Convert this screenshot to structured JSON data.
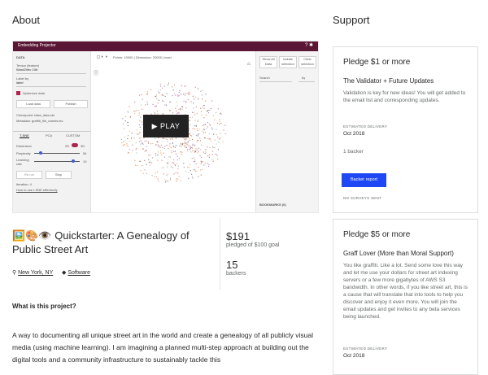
{
  "about_heading": "About",
  "support_heading": "Support",
  "video": {
    "app_title": "Embedding Projector",
    "data_label": "DATA",
    "tensor_label": "Tensor (feature)",
    "tensor_value": "Word2Vec 10K",
    "label_by_label": "Label by",
    "label_by_value": "label",
    "sphereize_label": "Sphereize data",
    "load_btn": "Load data",
    "publish_btn": "Publish",
    "checkpoint_text": "Checkpoint: false_data.ckt",
    "metadata_text": "Metadata: graffiti_file_names.tsv",
    "tabs": [
      "T-SNE",
      "PCA",
      "CUSTOM"
    ],
    "dimension_label": "Dimension",
    "dim_2d": "2D",
    "dim_3d": "3D",
    "perplexity_label": "Perplexity",
    "perplexity_value": "54",
    "learning_label": "Learning rate",
    "learning_value": "10",
    "rerun_btn": "Re-run",
    "stop_btn": "Stop",
    "iteration_text": "Iteration: 4",
    "how_link": "How to use t-SNE effectively",
    "points_text": "Points: 10000 | Dimension: 20000 | inset",
    "show_all_btn": "Show All Data",
    "isolate_btn": "Isolate selection",
    "clear_btn": "Clear selection",
    "search_label": "Search",
    "by_label": "by",
    "bookmarks_label": "BOOKMARKS (0)",
    "play_label": "PLAY"
  },
  "project": {
    "emoji": "🖼️🎨👁️",
    "title": "Quickstarter: A Genealogy of Public Street Art",
    "location": "New York, NY",
    "category": "Software",
    "pledged_amount": "$191",
    "pledged_sub": "pledged of $100 goal",
    "backers_count": "15",
    "backers_label": "backers",
    "what_heading": "What is this project?",
    "description": "A way to documenting all unique street art in the world and create a genealogy of all publicly visual media (using machine learning). I am imagining a planned multi-step approach at building out the digital tools and a community infrastructure to sustainably tackle this"
  },
  "pledges": [
    {
      "heading": "Pledge $1 or more",
      "title": "The Validator + Future Updates",
      "description": "Validation is key for new ideas! You will get added to the email list and corresponding updates.",
      "delivery_label": "ESTIMATED DELIVERY",
      "delivery_value": "Oct 2018",
      "backers": "1 backer",
      "button": "Backer report",
      "survey": "NO SURVEYS SENT"
    },
    {
      "heading": "Pledge $5 or more",
      "title": "Graff Lover (More than Moral Support)",
      "description": "You like graffiti. Like a lot. Send some love this way and let me use your dollars for street art indexing servers or a few more gigabytes of AWS S3 bandwidth. In other words, if you like street art, this is a cause that will translate that into tools to help you discover and enjoy it even more. You will join the email updates and get invites to any beta services being launched.",
      "delivery_label": "ESTIMATED DELIVERY",
      "delivery_value": "Oct 2018"
    }
  ],
  "colors": {
    "video_bar": "#5a1634",
    "accent_button": "#1e47f5"
  }
}
